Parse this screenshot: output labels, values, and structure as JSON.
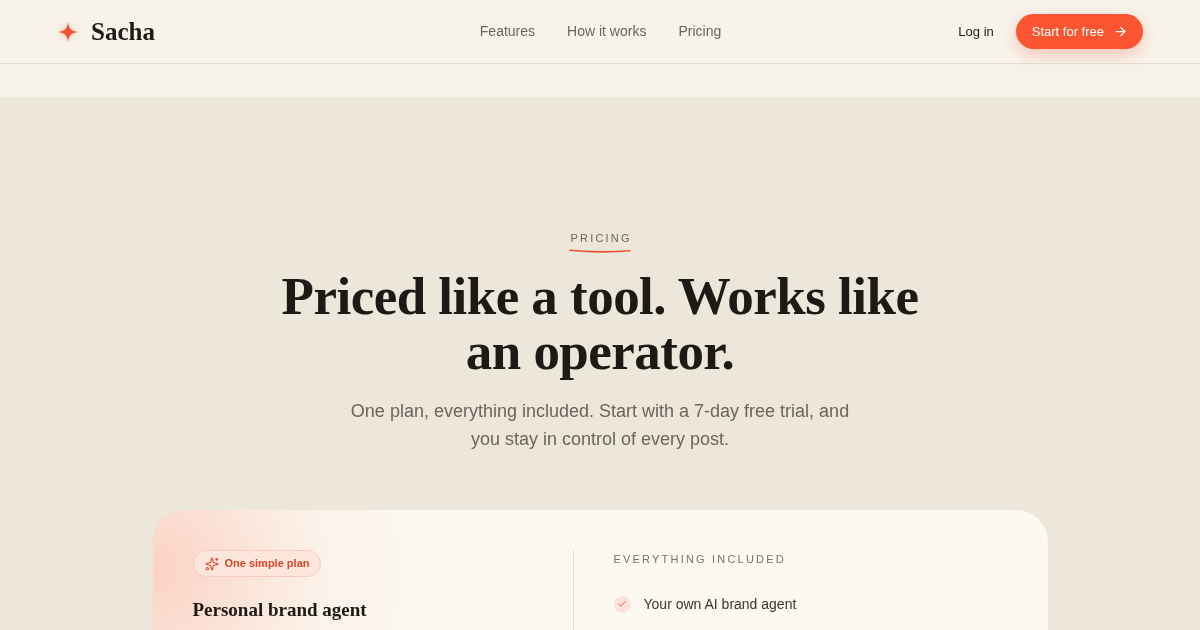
{
  "header": {
    "logo": "Sacha",
    "nav": [
      "Features",
      "How it works",
      "Pricing"
    ],
    "login": "Log in",
    "cta": "Start for free"
  },
  "hero": {
    "eyebrow": "PRICING",
    "title": "Priced like a tool. Works like an operator.",
    "subtitle": "One plan, everything included. Start with a 7-day free trial, and you stay in control of every post."
  },
  "plan_card": {
    "badge": "One simple plan",
    "name": "Personal brand agent",
    "features_heading": "EVERYTHING INCLUDED",
    "features": [
      "Your own AI brand agent"
    ]
  }
}
